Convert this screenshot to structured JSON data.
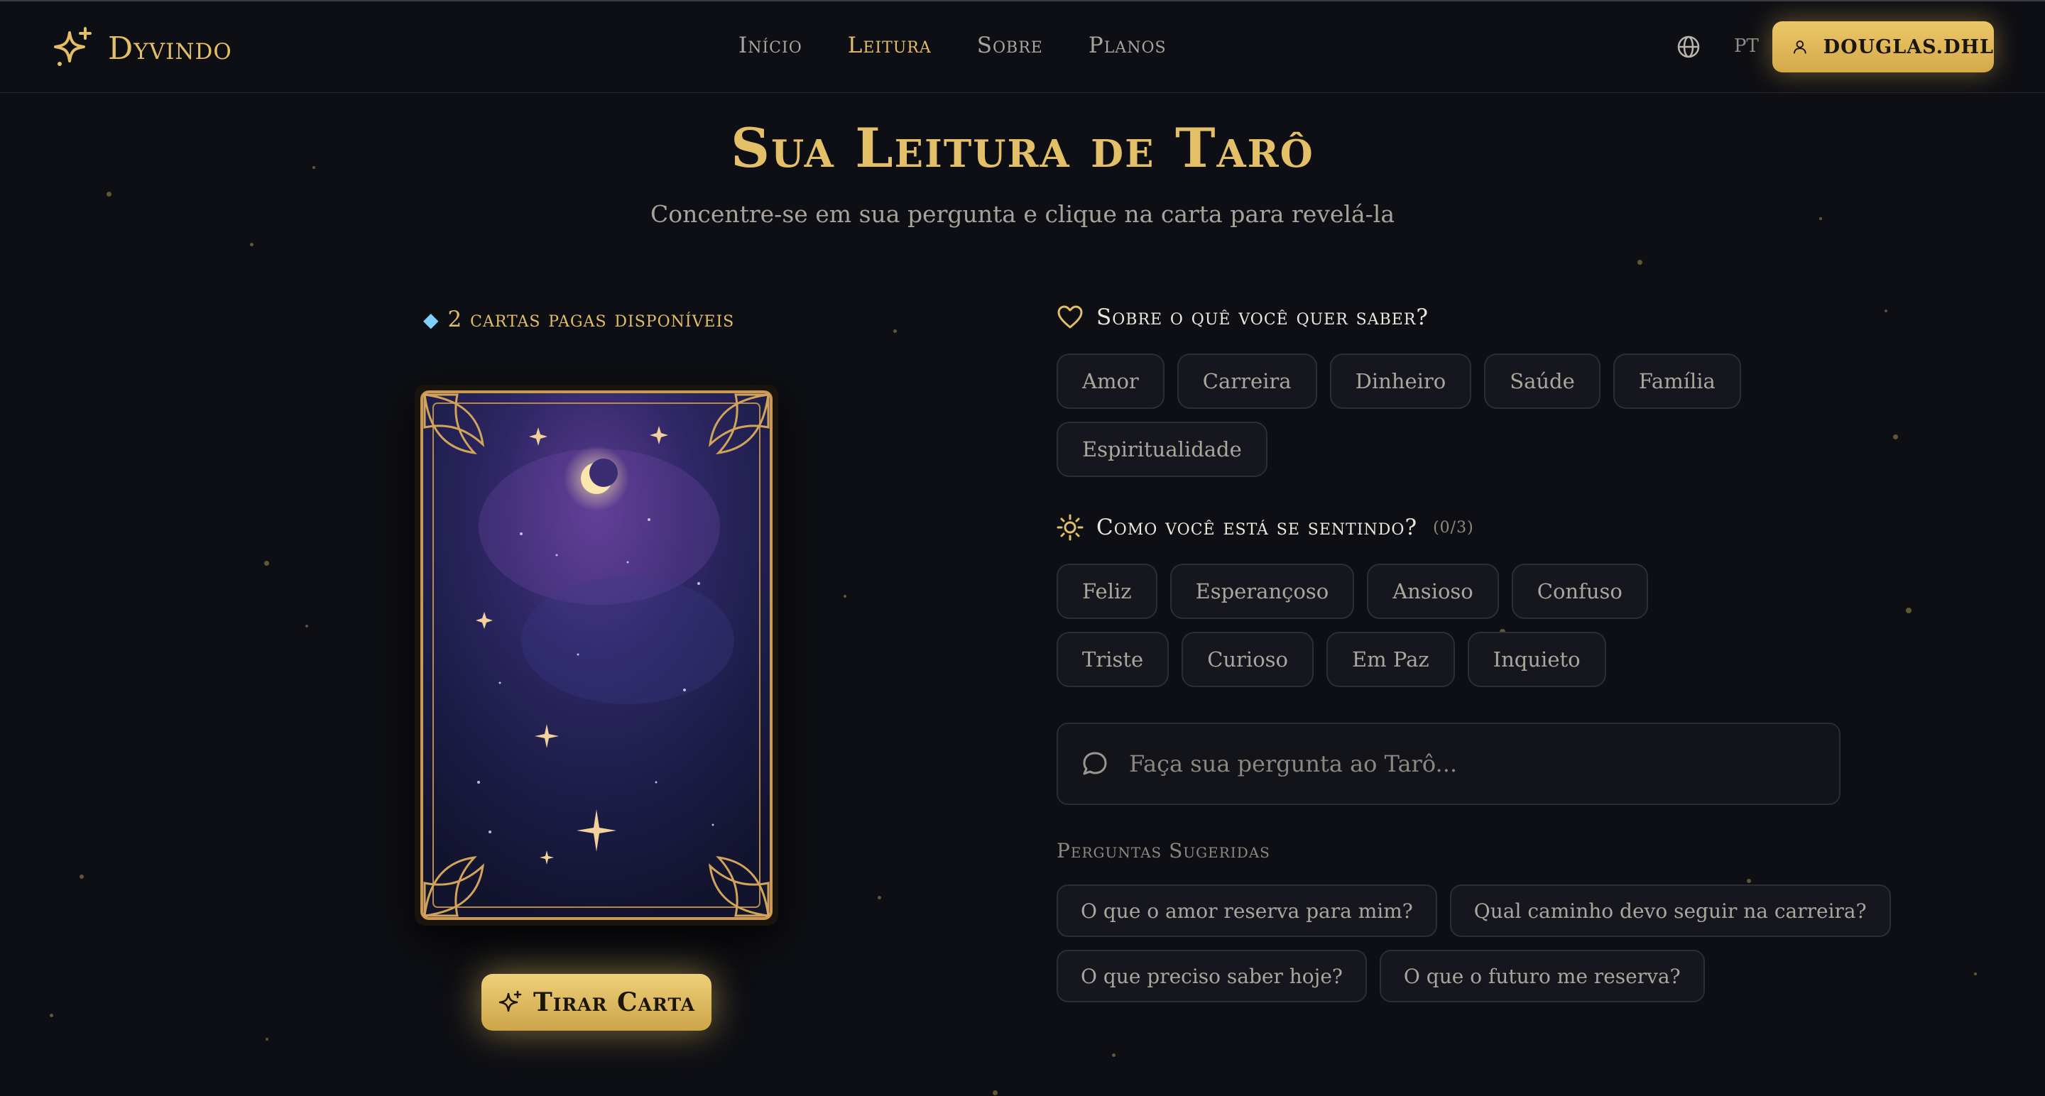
{
  "nav": {
    "brand": "Dyvindo",
    "items": [
      {
        "label": "Início",
        "active": false
      },
      {
        "label": "Leitura",
        "active": true
      },
      {
        "label": "Sobre",
        "active": false
      },
      {
        "label": "Planos",
        "active": false
      }
    ],
    "language": "PT",
    "user": "DOUGLAS.DHL"
  },
  "header": {
    "title": "Sua Leitura de Tarô",
    "subtitle": "Concentre-se em sua pergunta e clique na carta para revelá-la"
  },
  "left": {
    "credits": "2 cartas pagas disponíveis",
    "draw_button": "Tirar Carta"
  },
  "topics": {
    "heading": "Sobre o quê você quer saber?",
    "options": [
      "Amor",
      "Carreira",
      "Dinheiro",
      "Saúde",
      "Família",
      "Espiritualidade"
    ]
  },
  "feelings": {
    "heading": "Como você está se sentindo?",
    "count": "(0/3)",
    "options": [
      "Feliz",
      "Esperançoso",
      "Ansioso",
      "Confuso",
      "Triste",
      "Curioso",
      "Em Paz",
      "Inquieto"
    ]
  },
  "question": {
    "placeholder": "Faça sua pergunta ao Tarô..."
  },
  "suggested": {
    "heading": "Perguntas Sugeridas",
    "items": [
      "O que o amor reserva para mim?",
      "Qual caminho devo seguir na carreira?",
      "O que preciso saber hoje?",
      "O que o futuro me reserva?"
    ]
  },
  "colors": {
    "background": "#0e0f14",
    "gold": "#e2bf66",
    "chip_border": "#2c2d36"
  },
  "icons": {
    "brand": "sparkle-icon",
    "language": "globe-icon",
    "user": "user-icon",
    "topics": "heart-icon",
    "feelings": "sun-icon",
    "question": "chat-bubble-icon",
    "credits": "gem-icon",
    "draw": "sparkle-icon"
  }
}
